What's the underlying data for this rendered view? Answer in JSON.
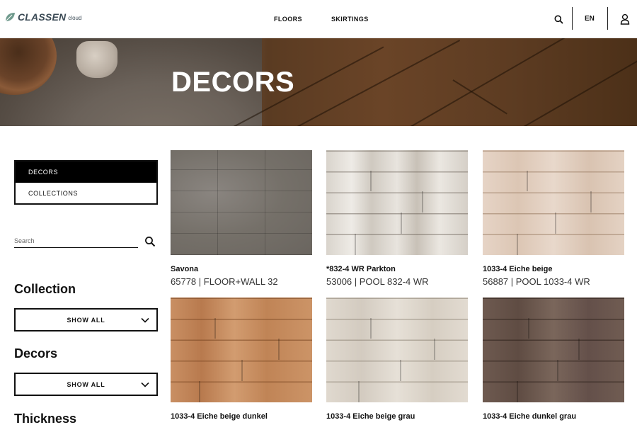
{
  "header": {
    "logo_text": "CLASSEN",
    "logo_sub": "cloud",
    "nav": [
      {
        "label": "FLOORS"
      },
      {
        "label": "SKIRTINGS"
      }
    ],
    "language": "EN",
    "icons": [
      "search-icon",
      "user-icon"
    ]
  },
  "hero": {
    "title": "DECORS"
  },
  "sidebar": {
    "tabs": [
      {
        "label": "DECORS",
        "active": true
      },
      {
        "label": "COLLECTIONS",
        "active": false
      }
    ],
    "search": {
      "placeholder": "Search",
      "value": ""
    },
    "filters": [
      {
        "heading": "Collection",
        "selected": "SHOW ALL"
      },
      {
        "heading": "Decors",
        "selected": "SHOW ALL"
      },
      {
        "heading": "Thickness"
      }
    ]
  },
  "products": [
    {
      "name": "Savona",
      "code": "65778 | FLOOR+WALL 32"
    },
    {
      "name": "*832-4 WR Parkton",
      "code": "53006 | POOL 832-4 WR"
    },
    {
      "name": "1033-4 Eiche beige",
      "code": "56887 | POOL 1033-4 WR"
    },
    {
      "name": "1033-4 Eiche beige dunkel",
      "code": ""
    },
    {
      "name": "1033-4 Eiche beige grau",
      "code": ""
    },
    {
      "name": "1033-4 Eiche dunkel grau",
      "code": ""
    }
  ],
  "colors": {
    "active_tab_bg": "#000000",
    "text": "#111111",
    "logo": "#3b4a55",
    "logo_leaf": "#6f9a8d"
  }
}
